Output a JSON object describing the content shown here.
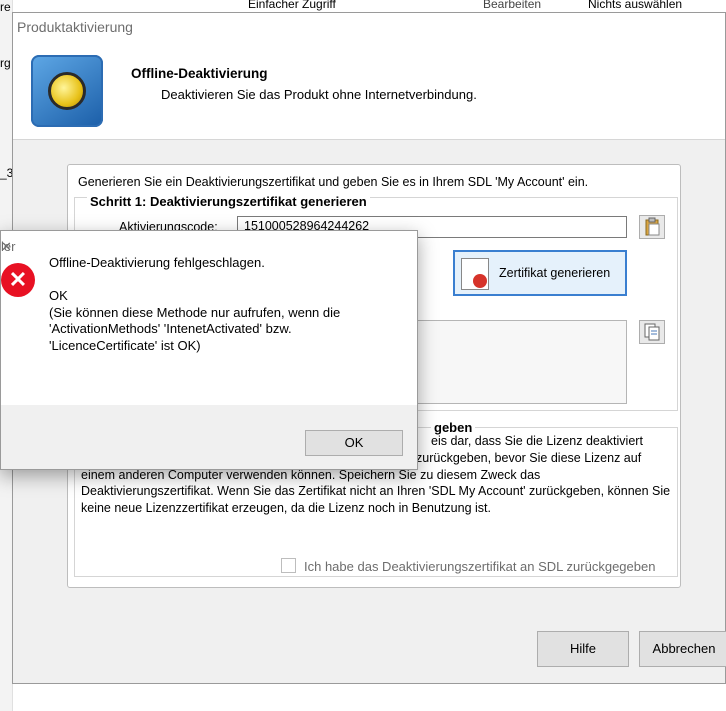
{
  "background_app": {
    "ribbon": {
      "quick_access": "Einfacher Zugriff",
      "edit": "Bearbeiten",
      "select_none": "Nichts auswählen"
    },
    "side_fragments": [
      "re",
      "rg",
      "_3"
    ]
  },
  "main_dialog": {
    "title": "Produktaktivierung",
    "header": {
      "title": "Offline-Deaktivierung",
      "subtitle": "Deaktivieren Sie das Produkt ohne Internetverbindung."
    },
    "intro": "Generieren Sie ein Deaktivierungszertifikat und geben Sie es in Ihrem SDL 'My Account' ein.",
    "step1": {
      "title": "Schritt 1: Deaktivierungszertifikat generieren",
      "activation_label": "Aktivierungscode:",
      "activation_code": "151000528964244262",
      "generate_button": "Zertifikat generieren"
    },
    "step2": {
      "title_fragment": "geben",
      "text_fragment": "eis dar, dass Sie die Lizenz deaktiviert",
      "text": "haben. Sie müssen das Zertifikat an Ihren 'SDL My Account' zurückgeben, bevor Sie diese Lizenz auf einem anderen Computer verwenden können. Speichern Sie zu diesem Zweck das Deaktivierungszertifikat. Wenn Sie das Zertifikat nicht an Ihren 'SDL My Account' zurückgeben, können Sie keine neue Lizenzzertifikat erzeugen, da die Lizenz noch in Benutzung ist.",
      "confirm_checkbox": "Ich habe das Deaktivierungszertifikat an SDL zurückgegeben",
      "confirm_checked": false
    },
    "buttons": {
      "help": "Hilfe",
      "cancel": "Abbrechen"
    }
  },
  "error_dialog": {
    "title_fragment": "ler",
    "close_icon": "close-icon",
    "message_lines": [
      "Offline-Deaktivierung fehlgeschlagen.",
      "",
      "OK",
      "(Sie können diese Methode nur aufrufen, wenn die",
      "'ActivationMethods' 'IntenetActivated' bzw.",
      "'LicenceCertificate' ist OK)"
    ],
    "ok_button": "OK",
    "icon_color": "#e81123"
  }
}
